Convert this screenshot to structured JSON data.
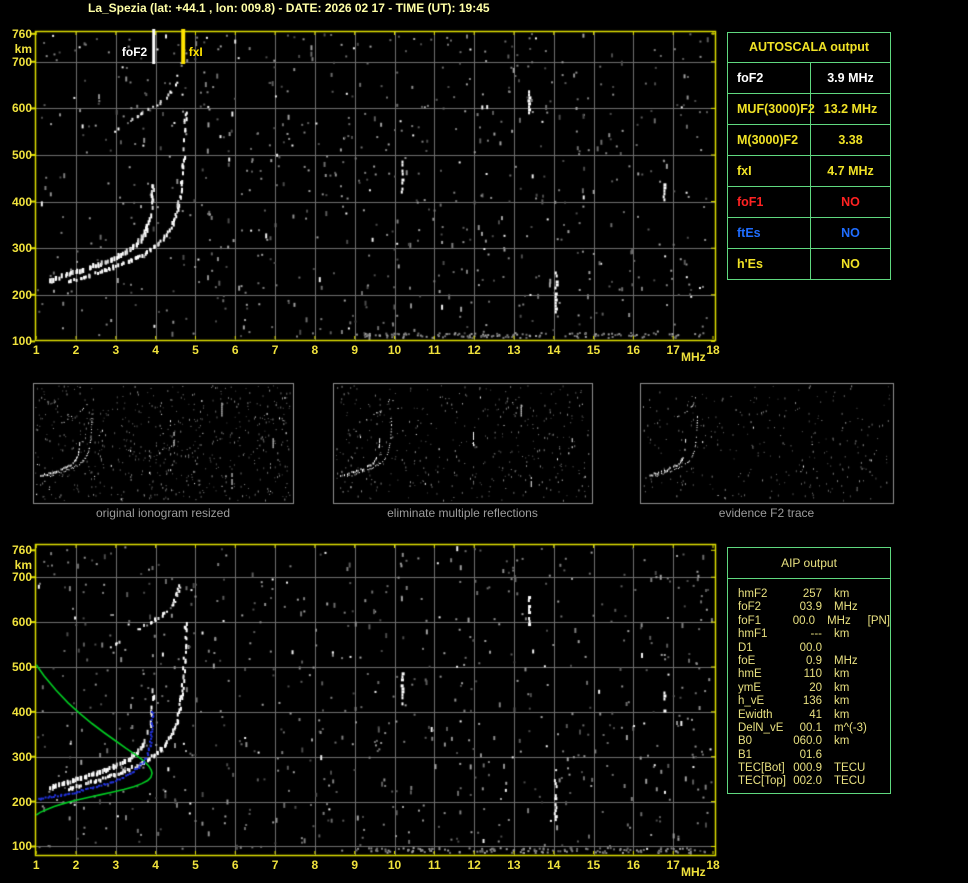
{
  "title": "La_Spezia (lat: +44.1 , lon: 009.8) - DATE: 2026 02 17 - TIME (UT): 19:45",
  "axes": {
    "x_ticks": [
      1,
      2,
      3,
      4,
      5,
      6,
      7,
      8,
      9,
      10,
      11,
      12,
      13,
      14,
      15,
      16,
      17,
      18
    ],
    "x_unit": "MHz",
    "y_ticks": [
      760,
      700,
      600,
      500,
      400,
      300,
      200,
      100
    ],
    "y_unit": "km"
  },
  "top_plot": {
    "markers": [
      {
        "id": "foF2",
        "label": "foF2",
        "mhz": 3.94,
        "color": "#ffffff"
      },
      {
        "id": "fxI",
        "label": "fxI",
        "mhz": 4.68,
        "color": "#ffe400"
      }
    ]
  },
  "autoscala": {
    "title": "AUTOSCALA output",
    "rows": [
      {
        "label": "foF2",
        "value": "3.9 MHz",
        "color": "#ffffff"
      },
      {
        "label": "MUF(3000)F2",
        "value": "13.2 MHz",
        "color": "#f0e226"
      },
      {
        "label": "M(3000)F2",
        "value": "3.38",
        "color": "#f0e226"
      },
      {
        "label": "fxI",
        "value": "4.7 MHz",
        "color": "#f0e226"
      },
      {
        "label": "foF1",
        "value": "NO",
        "color": "#ff2222"
      },
      {
        "label": "ftEs",
        "value": "NO",
        "color": "#1f6dff"
      },
      {
        "label": "h'Es",
        "value": "NO",
        "color": "#f0e226"
      }
    ]
  },
  "thumbnails": [
    {
      "caption": "original ionogram resized"
    },
    {
      "caption": "eliminate multiple reflections"
    },
    {
      "caption": "evidence F2 trace"
    }
  ],
  "aip": {
    "title": "AIP output",
    "rows": [
      {
        "label": "hmF2",
        "value": "257",
        "unit": "km",
        "extra": ""
      },
      {
        "label": "foF2",
        "value": "03.9",
        "unit": "MHz",
        "extra": ""
      },
      {
        "label": "foF1",
        "value": "00.0",
        "unit": "MHz",
        "extra": "[PN]"
      },
      {
        "label": "hmF1",
        "value": "---",
        "unit": "km",
        "extra": ""
      },
      {
        "label": "D1",
        "value": "00.0",
        "unit": "",
        "extra": ""
      },
      {
        "label": "foE",
        "value": "0.9",
        "unit": "MHz",
        "extra": ""
      },
      {
        "label": "hmE",
        "value": "110",
        "unit": "km",
        "extra": ""
      },
      {
        "label": "ymE",
        "value": "20",
        "unit": "km",
        "extra": ""
      },
      {
        "label": "h_vE",
        "value": "136",
        "unit": "km",
        "extra": ""
      },
      {
        "label": "Ewidth",
        "value": "41",
        "unit": "km",
        "extra": ""
      },
      {
        "label": "DelN_vE",
        "value": "00.1",
        "unit": "m^(-3)",
        "extra": ""
      },
      {
        "label": "B0",
        "value": "060.0",
        "unit": "km",
        "extra": ""
      },
      {
        "label": "B1",
        "value": "01.6",
        "unit": "",
        "extra": ""
      },
      {
        "label": "TEC[Bot]",
        "value": "000.9",
        "unit": "TECU",
        "extra": ""
      },
      {
        "label": "TEC[Top]",
        "value": "002.0",
        "unit": "TECU",
        "extra": ""
      }
    ]
  },
  "ionogram": {
    "o_trace": {
      "pts": [
        [
          1.35,
          230
        ],
        [
          1.6,
          238
        ],
        [
          1.9,
          246
        ],
        [
          2.2,
          254
        ],
        [
          2.5,
          262
        ],
        [
          2.8,
          271
        ],
        [
          3.05,
          281
        ],
        [
          3.3,
          293
        ],
        [
          3.5,
          306
        ],
        [
          3.65,
          320
        ],
        [
          3.77,
          338
        ],
        [
          3.85,
          360
        ],
        [
          3.9,
          388
        ],
        [
          3.93,
          415
        ],
        [
          3.95,
          450
        ]
      ],
      "th": 4,
      "gap": 0.05,
      "fade": 340,
      "gap_hi": 0.55
    },
    "x_trace": {
      "pts": [
        [
          1.8,
          228
        ],
        [
          2.1,
          235
        ],
        [
          2.4,
          243
        ],
        [
          2.7,
          251
        ],
        [
          3.0,
          260
        ],
        [
          3.3,
          270
        ],
        [
          3.6,
          282
        ],
        [
          3.85,
          295
        ],
        [
          4.08,
          310
        ],
        [
          4.28,
          328
        ],
        [
          4.43,
          350
        ],
        [
          4.54,
          378
        ],
        [
          4.62,
          412
        ],
        [
          4.68,
          452
        ],
        [
          4.72,
          500
        ],
        [
          4.745,
          550
        ],
        [
          4.76,
          598
        ]
      ],
      "th": 3,
      "gap": 0.18,
      "fade": 460,
      "gap_hi": 0.55
    },
    "hop_trace": {
      "pts": [
        [
          2.9,
          546
        ],
        [
          3.15,
          560
        ],
        [
          3.4,
          574
        ],
        [
          3.65,
          588
        ],
        [
          3.9,
          600
        ],
        [
          4.12,
          612
        ],
        [
          4.32,
          626
        ],
        [
          4.47,
          646
        ],
        [
          4.57,
          668
        ],
        [
          4.64,
          690
        ]
      ],
      "th": 2,
      "gap": 0.55,
      "fade": 999,
      "gap_hi": 0.7
    },
    "rfi": [
      [
        13.38,
        585,
        658
      ],
      [
        10.2,
        418,
        488
      ],
      [
        16.78,
        402,
        452
      ],
      [
        14.05,
        162,
        250
      ]
    ],
    "profile_green": [
      [
        1.0,
        505
      ],
      [
        1.2,
        480
      ],
      [
        1.5,
        448
      ],
      [
        1.8,
        420
      ],
      [
        2.1,
        396
      ],
      [
        2.4,
        374
      ],
      [
        2.7,
        354
      ],
      [
        3.0,
        335
      ],
      [
        3.25,
        319
      ],
      [
        3.5,
        304
      ],
      [
        3.7,
        291
      ],
      [
        3.82,
        280
      ],
      [
        3.89,
        270
      ],
      [
        3.91,
        263
      ],
      [
        3.88,
        254
      ],
      [
        3.8,
        247
      ],
      [
        3.65,
        240
      ],
      [
        3.45,
        233
      ],
      [
        3.2,
        227
      ],
      [
        2.9,
        221
      ],
      [
        2.6,
        215
      ],
      [
        2.3,
        209
      ],
      [
        2.0,
        203
      ],
      [
        1.7,
        196
      ],
      [
        1.45,
        189
      ],
      [
        1.25,
        182
      ],
      [
        1.1,
        176
      ],
      [
        1.0,
        170
      ]
    ],
    "fit_blue": [
      [
        1.05,
        206
      ],
      [
        1.3,
        210
      ],
      [
        1.6,
        214
      ],
      [
        1.9,
        219
      ],
      [
        2.2,
        225
      ],
      [
        2.5,
        232
      ],
      [
        2.8,
        240
      ],
      [
        3.05,
        248
      ],
      [
        3.3,
        258
      ],
      [
        3.5,
        270
      ],
      [
        3.65,
        283
      ],
      [
        3.77,
        298
      ],
      [
        3.85,
        318
      ],
      [
        3.89,
        340
      ],
      [
        3.91,
        362
      ],
      [
        3.92,
        382
      ],
      [
        3.93,
        404
      ]
    ],
    "colors": {
      "green": "#00cc22",
      "blue": "#2233dd",
      "white": "#ffffff",
      "rfi": "#ffffff",
      "plot_border": "#e0e000",
      "grid": "#6e6e6e",
      "tick": "#f0e23c",
      "thumb_border": "#8f8f8f"
    }
  }
}
